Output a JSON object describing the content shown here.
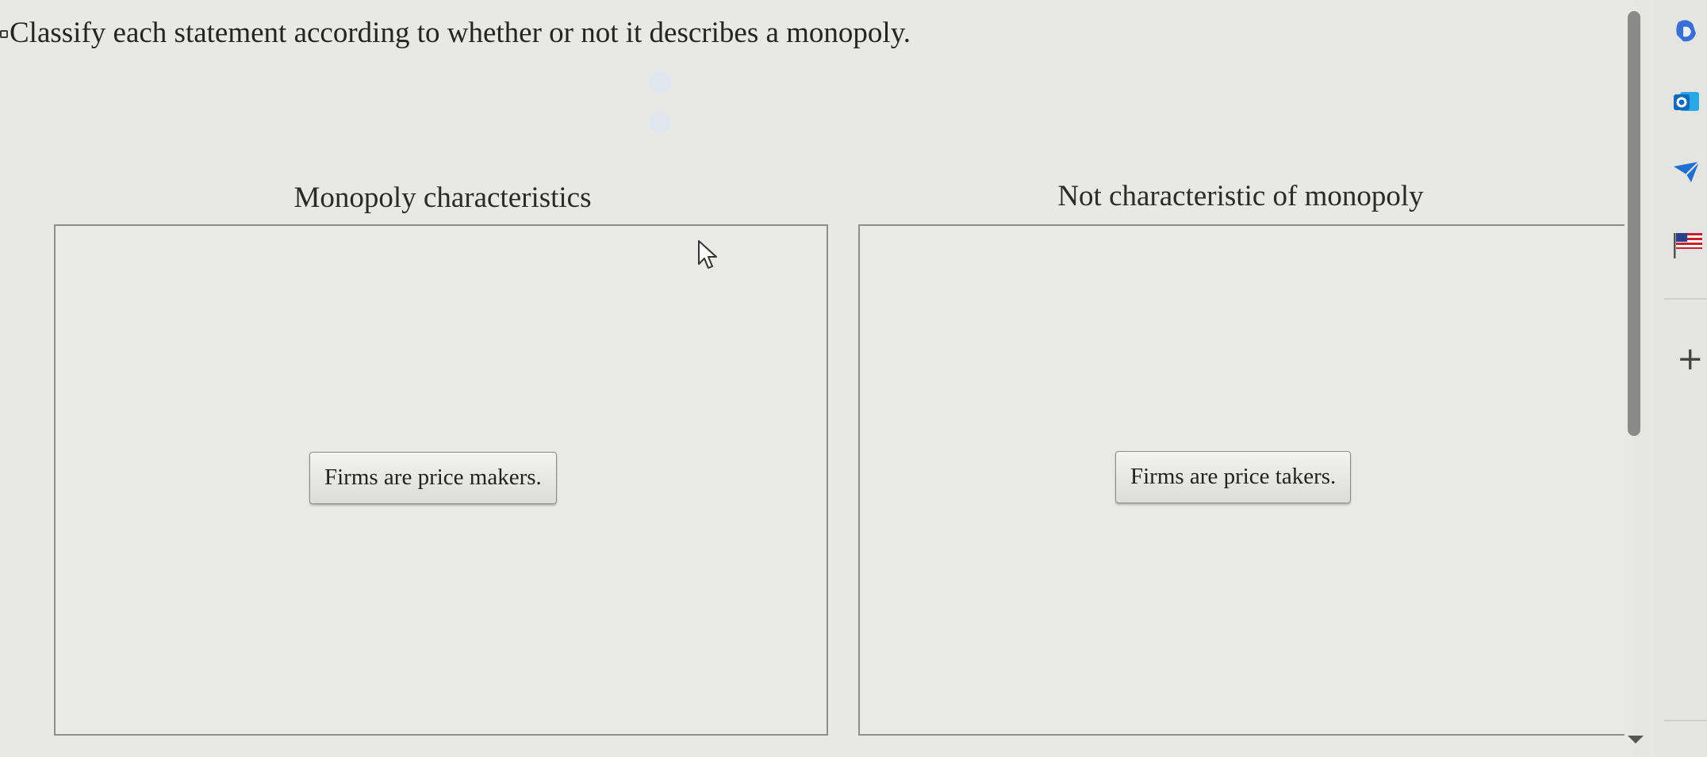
{
  "prompt": "Classify each statement according to whether or not it describes a monopoly.",
  "columns": [
    {
      "heading": "Monopoly characteristics",
      "items": [
        "Firms are price makers."
      ]
    },
    {
      "heading": "Not characteristic of monopoly",
      "items": [
        "Firms are price takers."
      ]
    }
  ],
  "sidebar": {
    "icons": [
      "copilot-icon",
      "outlook-icon",
      "send-icon",
      "flag-icon",
      "add-icon"
    ],
    "add_label": "+"
  },
  "colors": {
    "background": "#e8e8e6",
    "border": "#8e8e8e",
    "outlook_blue": "#0f6cbd"
  }
}
